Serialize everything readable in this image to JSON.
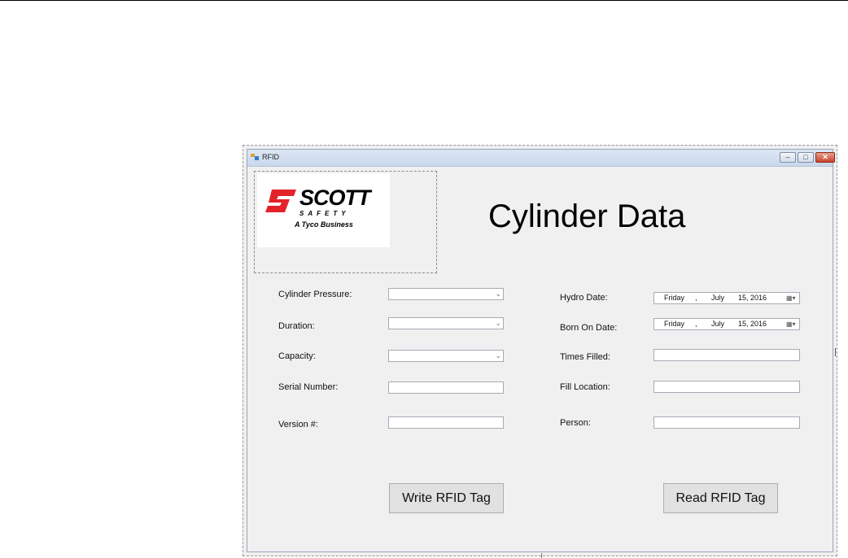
{
  "window": {
    "title": "RFID",
    "controls": {
      "minimize": "–",
      "maximize": "□",
      "close": "✕"
    }
  },
  "logo": {
    "brand": "SCOTT",
    "sub": "SAFETY",
    "tagline": "A Tyco Business",
    "brand_color": "#e3222a"
  },
  "heading": "Cylinder Data",
  "left_fields": [
    {
      "label": "Cylinder Pressure:",
      "type": "combo",
      "value": ""
    },
    {
      "label": "Duration:",
      "type": "combo",
      "value": ""
    },
    {
      "label": "Capacity:",
      "type": "combo",
      "value": ""
    },
    {
      "label": "Serial Number:",
      "type": "text",
      "value": ""
    },
    {
      "label": "Version #:",
      "type": "text",
      "value": ""
    }
  ],
  "right_fields": [
    {
      "label": "Hydro Date:",
      "type": "date",
      "day": "Friday",
      "sep": ",",
      "month": "July",
      "date": "15, 2016"
    },
    {
      "label": "Born On Date:",
      "type": "date",
      "day": "Friday",
      "sep": ",",
      "month": "July",
      "date": "15, 2016"
    },
    {
      "label": "Times Filled:",
      "type": "text",
      "value": ""
    },
    {
      "label": "Fill Location:",
      "type": "text",
      "value": ""
    },
    {
      "label": "Person:",
      "type": "text",
      "value": ""
    }
  ],
  "buttons": {
    "write": "Write RFID Tag",
    "read": "Read RFID Tag"
  },
  "icons": {
    "dropdown": "chevron-down-icon",
    "calendar": "calendar-icon"
  }
}
